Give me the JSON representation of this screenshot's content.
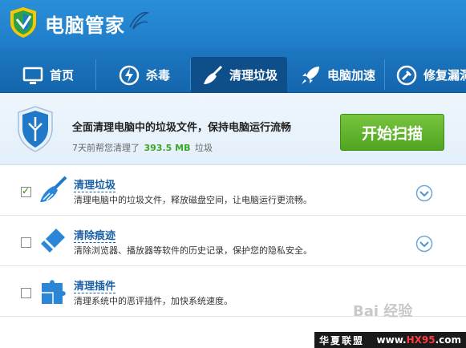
{
  "app": {
    "title": "电脑管家"
  },
  "nav": {
    "tabs": [
      {
        "label": "首页",
        "icon": "monitor-icon"
      },
      {
        "label": "杀毒",
        "icon": "shield-bolt-icon"
      },
      {
        "label": "清理垃圾",
        "icon": "broom-icon",
        "active": true
      },
      {
        "label": "电脑加速",
        "icon": "rocket-icon"
      },
      {
        "label": "修复漏洞",
        "icon": "repair-icon"
      }
    ]
  },
  "summary": {
    "title": "全面清理电脑中的垃圾文件，保持电脑运行流畅",
    "sub_prefix": "7天前帮您清理了",
    "amount": "393.5 MB",
    "sub_suffix": "垃圾",
    "scan_button": "开始扫描"
  },
  "items": [
    {
      "title": "清理垃圾",
      "desc": "清理电脑中的垃圾文件，释放磁盘空间，让电脑运行更流畅。",
      "checked": true,
      "icon": "broom-icon"
    },
    {
      "title": "清除痕迹",
      "desc": "清除浏览器、播放器等软件的历史记录，保护您的隐私安全。",
      "checked": false,
      "icon": "eraser-icon"
    },
    {
      "title": "清理插件",
      "desc": "清理系统中的恶评插件，加快系统速度。",
      "checked": false,
      "icon": "puzzle-icon"
    }
  ],
  "watermark": "Bai 经验",
  "footer": {
    "left": "华夏联盟",
    "right_prefix": "www.",
    "right_hx": "HX95",
    "right_suffix": ".com"
  },
  "colors": {
    "accent": "#1f7cc8",
    "active_tab": "#0e4f8a",
    "scan_green": "#5bb12b",
    "amount_green": "#3aa526"
  }
}
